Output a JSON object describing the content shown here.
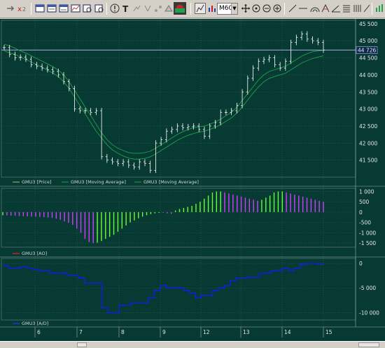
{
  "toolbar": {
    "timeframe": "M60",
    "icons": [
      "arrow-icon",
      "cursor-icon",
      "window-icon",
      "window-icon",
      "window-icon",
      "chart-icon",
      "zoom-icon",
      "zoom-icon",
      "info-icon",
      "text-icon",
      "tools-icon",
      "tools-icon",
      "tools-icon",
      "tools-icon",
      "market-icon",
      "chart-type-icon",
      "bar-chart-icon",
      "crosshair-icon",
      "target-icon",
      "zoom-out-icon",
      "zoom-in-icon",
      "line-icon",
      "hline-icon",
      "arc-icon",
      "fib-icon",
      "angle-icon",
      "grid-icon",
      "bars-icon",
      "slash-icon",
      "pause-icon"
    ]
  },
  "price_axis": [
    "45 500",
    "45 000",
    "44 500",
    "44 000",
    "43 500",
    "43 000",
    "42 500",
    "42 000",
    "41 500"
  ],
  "last_price": "44 726",
  "ao_axis": [
    "1 000",
    "500",
    "0",
    "-500",
    "-1 000",
    "-1 500"
  ],
  "ad_axis": [
    "0",
    "-5 000",
    "-10 000"
  ],
  "time_axis": [
    "6",
    "7",
    "8",
    "9",
    "12",
    "13",
    "14",
    "15"
  ],
  "legend": {
    "price": "GMU3 [Price]",
    "ma1": "GMU3 [Moving Average]",
    "ma2": "GMU3 [Moving Average]",
    "ao": "GMU3 [AO]",
    "ad": "GMU3 [A/D]"
  },
  "colors": {
    "background": "#073a33",
    "grid": "#3f5f58",
    "candles": "#ffffff",
    "ma": "#1fa14a",
    "ao_up": "#66ff33",
    "ao_down": "#d23cff",
    "ad": "#1020d8",
    "ao_legend": "#cc2222",
    "ad_legend": "#2233cc"
  },
  "chart_data": [
    {
      "type": "line",
      "title": "",
      "series": [
        {
          "name": "GMU3 [Price]",
          "values": [
            44800,
            44600,
            44500,
            44520,
            44460,
            44300,
            44250,
            44200,
            44150,
            44100,
            44000,
            43800,
            43600,
            43000,
            42950,
            42950,
            42900,
            42950,
            41600,
            41500,
            41450,
            41400,
            41450,
            41350,
            41300,
            41450,
            41400,
            41200,
            42000,
            42100,
            42350,
            42400,
            42500,
            42450,
            42480,
            42500,
            42400,
            42200,
            42500,
            42600,
            42900,
            42900,
            42950,
            43100,
            43500,
            43900,
            44200,
            44400,
            44450,
            44500,
            44300,
            44200,
            44400,
            44950,
            45100,
            45200,
            45050,
            45000,
            44950,
            44726
          ]
        },
        {
          "name": "GMU3 [Moving Average]",
          "values": [
            44900,
            44850,
            44780,
            44700,
            44640,
            44560,
            44480,
            44400,
            44320,
            44240,
            44140,
            44000,
            43800,
            43550,
            43300,
            43050,
            42800,
            42550,
            42300,
            42100,
            41950,
            41850,
            41780,
            41720,
            41700,
            41700,
            41720,
            41760,
            41850,
            41950,
            42050,
            42150,
            42250,
            42330,
            42400,
            42450,
            42480,
            42500,
            42550,
            42620,
            42700,
            42800,
            42900,
            43050,
            43250,
            43450,
            43650,
            43850,
            44000,
            44100,
            44150,
            44200,
            44250,
            44350,
            44450,
            44550,
            44620,
            44680,
            44700,
            44720
          ]
        },
        {
          "name": "GMU3 [Moving Average]",
          "values": [
            44700,
            44650,
            44600,
            44520,
            44450,
            44380,
            44300,
            44220,
            44140,
            44050,
            43950,
            43800,
            43600,
            43350,
            43100,
            42850,
            42600,
            42350,
            42150,
            41950,
            41800,
            41700,
            41620,
            41560,
            41530,
            41530,
            41550,
            41600,
            41680,
            41780,
            41880,
            41980,
            42080,
            42160,
            42230,
            42280,
            42320,
            42350,
            42400,
            42460,
            42540,
            42640,
            42740,
            42880,
            43060,
            43260,
            43460,
            43650,
            43800,
            43900,
            43950,
            44000,
            44050,
            44150,
            44250,
            44350,
            44420,
            44480,
            44520,
            44560
          ]
        }
      ],
      "ylim": [
        41000,
        45600
      ]
    },
    {
      "type": "bar",
      "title": "",
      "series": [
        {
          "name": "GMU3 [AO]",
          "values": [
            -150,
            -160,
            -170,
            -180,
            -190,
            -200,
            -210,
            -215,
            -220,
            -230,
            -240,
            -260,
            -280,
            -320,
            -380,
            -450,
            -520,
            -620,
            -800,
            -1000,
            -1300,
            -1450,
            -1500,
            -1480,
            -1400,
            -1300,
            -1200,
            -1100,
            -950,
            -800,
            -650,
            -500,
            -400,
            -300,
            -220,
            -150,
            -100,
            -60,
            -40,
            -20,
            -60,
            -90,
            80,
            150,
            200,
            250,
            300,
            400,
            500,
            650,
            800,
            950,
            1000,
            1000,
            950,
            900,
            850,
            800,
            750,
            700,
            650,
            600,
            550,
            600,
            700,
            800,
            950,
            1000,
            1000,
            950,
            900,
            850,
            800,
            750,
            700,
            650,
            600,
            550,
            500
          ]
        }
      ],
      "ylim": [
        -1700,
        1150
      ]
    },
    {
      "type": "line",
      "title": "",
      "series": [
        {
          "name": "GMU3 [A/D]",
          "values": [
            -500,
            -1000,
            -1000,
            -700,
            -900,
            -1200,
            -1500,
            -1500,
            -2000,
            -2000,
            -2000,
            -2500,
            -2500,
            -3000,
            -4000,
            -4000,
            -4000,
            -9000,
            -10000,
            -10000,
            -8500,
            -8500,
            -8000,
            -8000,
            -8000,
            -7000,
            -5500,
            -4500,
            -5000,
            -5000,
            -5000,
            -5500,
            -6000,
            -7000,
            -6500,
            -6500,
            -5500,
            -5000,
            -4500,
            -3500,
            -3000,
            -3000,
            -2800,
            -2800,
            -2000,
            -2000,
            -1500,
            -1500,
            -1000,
            -1500,
            -1000,
            -200,
            0,
            0,
            -200,
            -100
          ]
        }
      ],
      "ylim": [
        -11500,
        1000
      ]
    }
  ]
}
